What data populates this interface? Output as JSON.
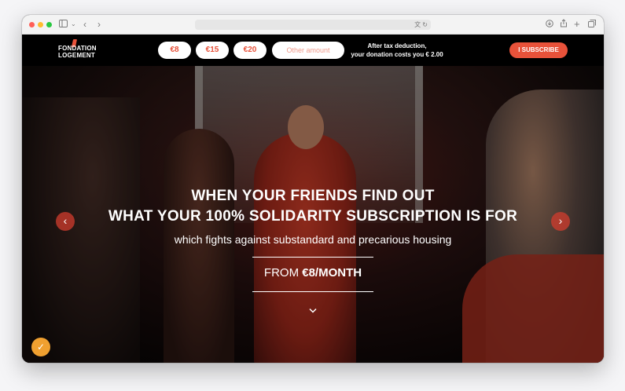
{
  "browser": {
    "icons": [
      "sidebar-icon",
      "chevron-down-icon",
      "back-icon",
      "forward-icon",
      "translate-icon",
      "reload-icon",
      "download-icon",
      "share-icon",
      "new-tab-icon",
      "tabs-overview-icon"
    ]
  },
  "nav": {
    "logo_line1": "FONDATION",
    "logo_line2": "LOGEMENT",
    "amounts": [
      "€8",
      "€15",
      "€20"
    ],
    "other_amount": "Other amount",
    "tax_line1": "After tax deduction,",
    "tax_line2": "your donation costs you € 2.00",
    "subscribe": "I SUBSCRIBE"
  },
  "hero": {
    "headline_line1": "WHEN YOUR FRIENDS FIND OUT",
    "headline_line2": "WHAT YOUR 100% SOLIDARITY SUBSCRIPTION IS FOR",
    "subheadline": "which fights against substandard and precarious housing",
    "price_prefix": "FROM",
    "price_value": "€8/MONTH"
  },
  "colors": {
    "accent": "#e8523a",
    "badge": "#f0a030"
  }
}
